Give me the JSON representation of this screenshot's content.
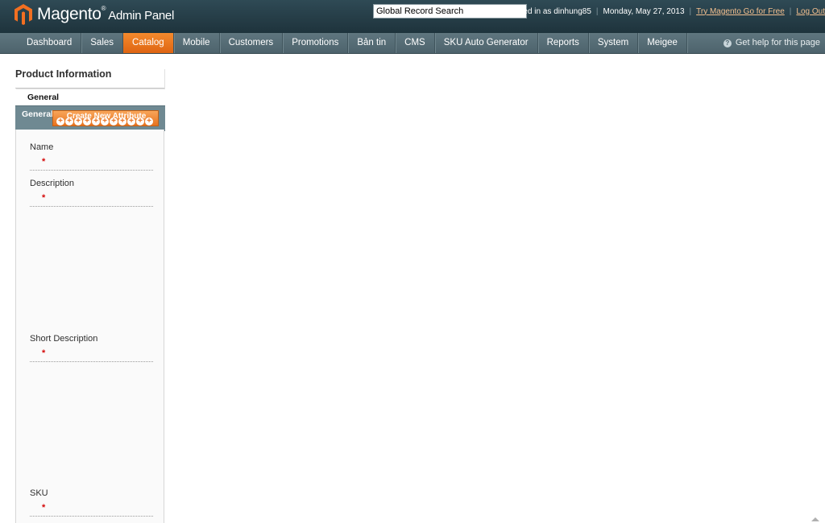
{
  "header": {
    "brand": "Magento",
    "brand_suffix": "Admin Panel",
    "search_value": "Global Record Search",
    "logged_in": "Logged in as dinhung85",
    "date": "Monday, May 27, 2013",
    "try_link": "Try Magento Go for Free",
    "logout": "Log Out"
  },
  "nav": {
    "items": [
      "Dashboard",
      "Sales",
      "Catalog",
      "Mobile",
      "Customers",
      "Promotions",
      "Bản tin",
      "CMS",
      "SKU Auto Generator",
      "Reports",
      "System",
      "Meigee"
    ],
    "active": "Catalog",
    "help": "Get help for this page"
  },
  "sidebar": {
    "title": "Product Information",
    "tab": "General"
  },
  "section": {
    "label": "General",
    "create_button": "Create New Attribute"
  },
  "fields": [
    {
      "label": "Name",
      "required": "*"
    },
    {
      "label": "Description",
      "required": "*"
    },
    {
      "label": "Short Description",
      "required": "*"
    },
    {
      "label": "SKU",
      "required": "*"
    }
  ],
  "colors": {
    "header_bg": "#1e333c",
    "nav_bg": "#4d636c",
    "active_tab": "#e8731f",
    "link": "#f3bf8f",
    "required": "#d40707"
  }
}
